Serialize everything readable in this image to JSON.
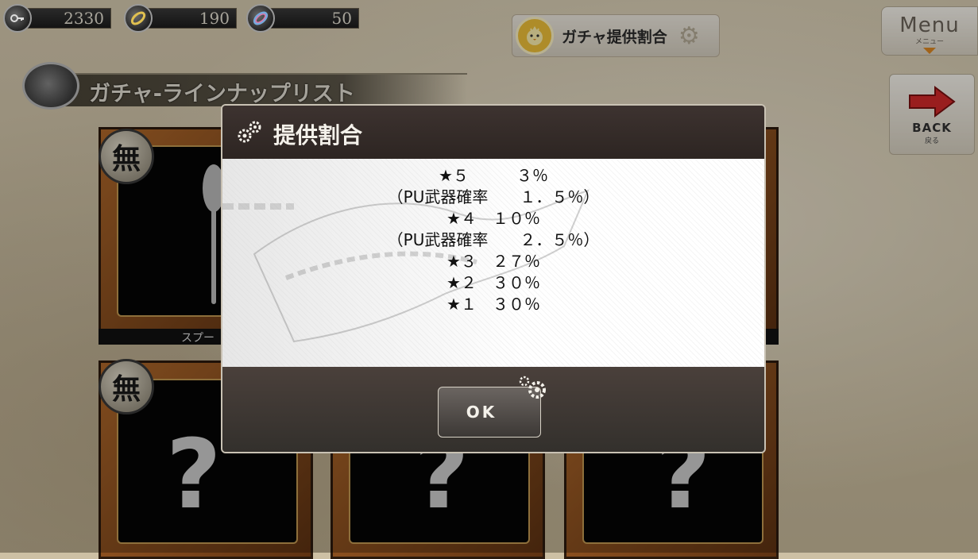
{
  "currencies": [
    {
      "icon": "key-coin-icon",
      "value": "2330"
    },
    {
      "icon": "gold-ring-icon",
      "value": "190"
    },
    {
      "icon": "rainbow-ring-icon",
      "value": "50"
    }
  ],
  "header": {
    "ratio_button_label": "ガチャ提供割合",
    "menu_label": "Menu",
    "menu_sublabel": "メニュー",
    "back_label": "BACK",
    "back_sublabel": "戻る"
  },
  "page_title": "ガチャ-ラインナップリスト",
  "cards": {
    "badge": "無",
    "item_name": "スプー",
    "unknown_mark": "?"
  },
  "modal": {
    "title": "提供割合",
    "rates": [
      "★５　　　３％",
      "（PU武器確率　　１．５％）",
      "★４　１０％",
      "（PU武器確率　　２．５％）",
      "★３　２７％",
      "★２　３０％",
      "★１　３０％"
    ],
    "ok_label": "OK"
  },
  "colors": {
    "accent_orange": "#e08a23",
    "back_arrow_red": "#d42a2a",
    "chick_yellow": "#f2c33a"
  }
}
